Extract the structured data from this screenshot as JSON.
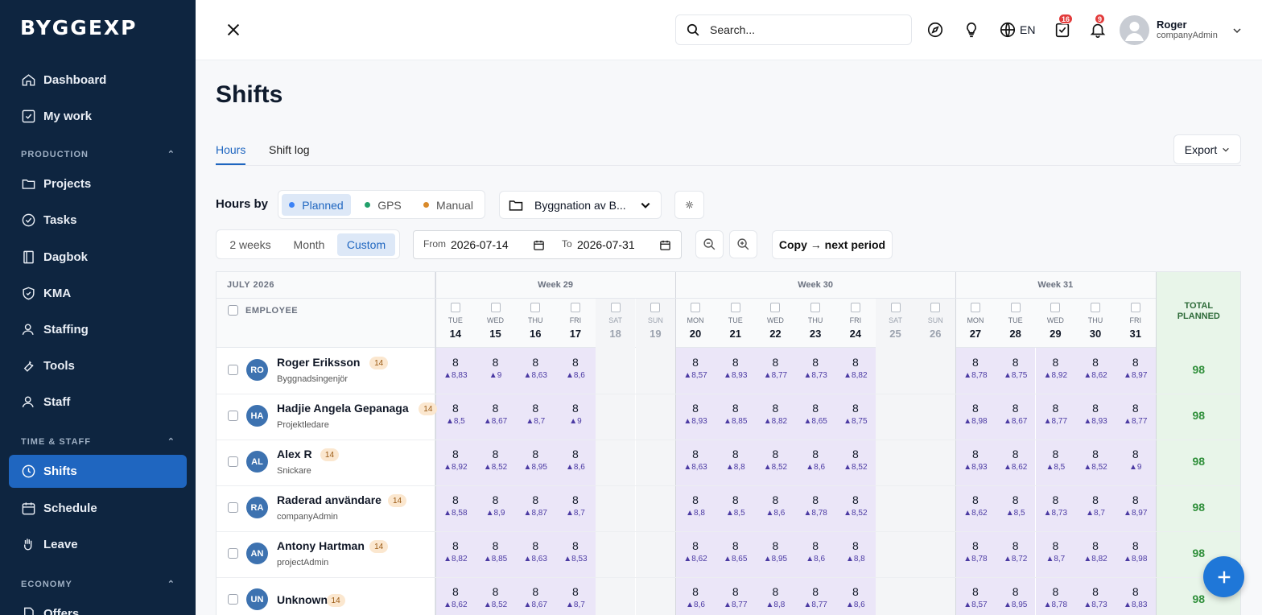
{
  "sidebar": {
    "logo": "BYGGEXP",
    "items": [
      {
        "label": "Dashboard",
        "icon": "home-icon"
      },
      {
        "label": "My work",
        "icon": "check-square-icon"
      },
      {
        "label": "Projects",
        "icon": "folder-icon"
      },
      {
        "label": "Tasks",
        "icon": "check-circle-icon"
      },
      {
        "label": "Dagbok",
        "icon": "book-icon"
      },
      {
        "label": "KMA",
        "icon": "shield-check-icon"
      },
      {
        "label": "Staffing",
        "icon": "user-icon"
      },
      {
        "label": "Tools",
        "icon": "wrench-icon"
      },
      {
        "label": "Staff",
        "icon": "user-icon"
      },
      {
        "label": "Shifts",
        "icon": "clock-icon",
        "active": true
      },
      {
        "label": "Schedule",
        "icon": "calendar-icon"
      },
      {
        "label": "Leave",
        "icon": "hand-icon"
      },
      {
        "label": "Offers",
        "icon": "document-icon"
      }
    ],
    "sections": [
      "PRODUCTION",
      "TIME & STAFF",
      "ECONOMY"
    ]
  },
  "topbar": {
    "search_placeholder": "Search...",
    "language": "EN",
    "tasks_badge": "16",
    "notifications_badge": "9",
    "user_name": "Roger",
    "user_role": "companyAdmin"
  },
  "page": {
    "title": "Shifts",
    "tabs": [
      "Hours",
      "Shift log"
    ],
    "export_label": "Export",
    "hours_by_label": "Hours by",
    "hours_by_options": [
      "Planned",
      "GPS",
      "Manual"
    ],
    "project_select": "Byggnation av B...",
    "range_options": [
      "2 weeks",
      "Month",
      "Custom"
    ],
    "from_label": "From",
    "from_value": "2026-07-14",
    "to_label": "To",
    "to_value": "2026-07-31",
    "copy_label": "Copy → next period"
  },
  "colors": {
    "accent": "#1f66c0",
    "planned": "#3b82f6",
    "gps": "#22a06b",
    "manual": "#d98a2b",
    "total": "#2f8f3a"
  },
  "grid": {
    "month_label": "JULY 2026",
    "employee_header": "EMPLOYEE",
    "total_header": [
      "TOTAL",
      "PLANNED"
    ],
    "weeks": [
      "Week 29",
      "Week 30",
      "Week 31"
    ],
    "days": [
      {
        "dow": "TUE",
        "d": "14"
      },
      {
        "dow": "WED",
        "d": "15"
      },
      {
        "dow": "THU",
        "d": "16"
      },
      {
        "dow": "FRI",
        "d": "17"
      },
      {
        "dow": "SAT",
        "d": "18",
        "we": true
      },
      {
        "dow": "SUN",
        "d": "19",
        "we": true
      },
      {
        "dow": "MON",
        "d": "20"
      },
      {
        "dow": "TUE",
        "d": "21"
      },
      {
        "dow": "WED",
        "d": "22"
      },
      {
        "dow": "THU",
        "d": "23"
      },
      {
        "dow": "FRI",
        "d": "24"
      },
      {
        "dow": "SAT",
        "d": "25",
        "we": true
      },
      {
        "dow": "SUN",
        "d": "26",
        "we": true
      },
      {
        "dow": "MON",
        "d": "27"
      },
      {
        "dow": "TUE",
        "d": "28"
      },
      {
        "dow": "WED",
        "d": "29"
      },
      {
        "dow": "THU",
        "d": "30"
      },
      {
        "dow": "FRI",
        "d": "31"
      }
    ],
    "planned_value": "8",
    "rows": [
      {
        "initials": "RO",
        "name": "Roger Eriksson",
        "badge": "14",
        "role": "Byggnadsingenjör",
        "total": "98",
        "actual": [
          "8,83",
          "9",
          "8,63",
          "8,6",
          "",
          "",
          "8,57",
          "8,93",
          "8,77",
          "8,73",
          "8,82",
          "",
          "",
          "8,78",
          "8,75",
          "8,92",
          "8,62",
          "8,97"
        ]
      },
      {
        "initials": "HA",
        "name": "Hadjie Angela Gepanaga",
        "badge": "14",
        "role": "Projektledare",
        "total": "98",
        "actual": [
          "8,5",
          "8,67",
          "8,7",
          "9",
          "",
          "",
          "8,93",
          "8,85",
          "8,82",
          "8,65",
          "8,75",
          "",
          "",
          "8,98",
          "8,67",
          "8,77",
          "8,93",
          "8,77"
        ]
      },
      {
        "initials": "AL",
        "name": "Alex R",
        "badge": "14",
        "role": "Snickare",
        "total": "98",
        "actual": [
          "8,92",
          "8,52",
          "8,95",
          "8,6",
          "",
          "",
          "8,63",
          "8,8",
          "8,52",
          "8,6",
          "8,52",
          "",
          "",
          "8,93",
          "8,62",
          "8,5",
          "8,52",
          "9"
        ]
      },
      {
        "initials": "RA",
        "name": "Raderad användare",
        "badge": "14",
        "role": "companyAdmin",
        "total": "98",
        "actual": [
          "8,58",
          "8,9",
          "8,87",
          "8,7",
          "",
          "",
          "8,8",
          "8,5",
          "8,6",
          "8,78",
          "8,52",
          "",
          "",
          "8,62",
          "8,5",
          "8,73",
          "8,7",
          "8,97"
        ]
      },
      {
        "initials": "AN",
        "name": "Antony Hartman",
        "badge": "14",
        "role": "projectAdmin",
        "total": "98",
        "actual": [
          "8,82",
          "8,85",
          "8,63",
          "8,53",
          "",
          "",
          "8,62",
          "8,65",
          "8,95",
          "8,6",
          "8,8",
          "",
          "",
          "8,78",
          "8,72",
          "8,7",
          "8,82",
          "8,98"
        ]
      },
      {
        "initials": "UN",
        "name": "Unknown",
        "badge": "14",
        "role": "",
        "total": "98",
        "actual": [
          "8,62",
          "8,52",
          "8,67",
          "8,7",
          "",
          "",
          "8,6",
          "8,77",
          "8,8",
          "8,77",
          "8,6",
          "",
          "",
          "8,57",
          "8,95",
          "8,78",
          "8,73",
          "8,83"
        ]
      }
    ]
  }
}
